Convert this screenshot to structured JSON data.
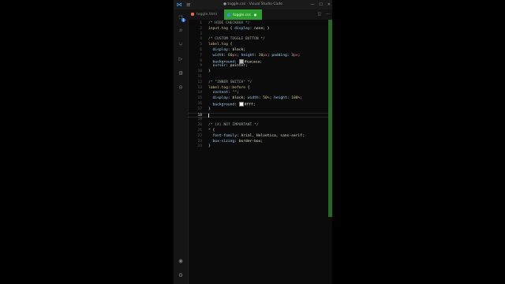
{
  "window": {
    "title": "● toggle.css - Visual Studio Code"
  },
  "colors": {
    "accent": "#2c9e2c",
    "background": "#0b0b0b",
    "swatch_tag": "#bbb",
    "swatch_fff": "#ffffff"
  },
  "icons": {
    "app": "vscode-logo-icon",
    "menu": "hamburger-menu-icon",
    "activity": [
      "explorer-icon",
      "search-icon",
      "source-control-icon",
      "run-debug-icon",
      "extensions-icon",
      "remote-icon",
      "account-icon",
      "settings-gear-icon"
    ]
  },
  "activity_bar": {
    "badge_count": "1"
  },
  "tabs": [
    {
      "label": "toggle.html",
      "active": false
    },
    {
      "label": "toggle.css",
      "active": true
    }
  ],
  "tab_actions": {
    "split": "◫",
    "more": "···"
  },
  "editor": {
    "lines": [
      {
        "num": "1",
        "tokens": [
          {
            "t": "c",
            "v": "/* HIDE CHECKBOX */"
          }
        ]
      },
      {
        "num": "2",
        "tokens": [
          {
            "t": "sel",
            "v": "input.tog "
          },
          {
            "t": "b",
            "v": "{ "
          },
          {
            "t": "p",
            "v": "display"
          },
          {
            "t": "b",
            "v": ": "
          },
          {
            "t": "v",
            "v": "none"
          },
          {
            "t": "b",
            "v": "; }"
          }
        ]
      },
      {
        "num": "3",
        "tokens": []
      },
      {
        "num": "4",
        "tokens": [
          {
            "t": "c",
            "v": "/* CUSTOM TOGGLE BUTTON */"
          }
        ]
      },
      {
        "num": "5",
        "tokens": [
          {
            "t": "sel",
            "v": "label.tog "
          },
          {
            "t": "b",
            "v": "{"
          }
        ]
      },
      {
        "num": "6",
        "tokens": [
          {
            "t": "p",
            "v": "  display"
          },
          {
            "t": "b",
            "v": ": "
          },
          {
            "t": "v",
            "v": "block"
          },
          {
            "t": "b",
            "v": ";"
          }
        ]
      },
      {
        "num": "7",
        "tokens": [
          {
            "t": "p",
            "v": "  width"
          },
          {
            "t": "b",
            "v": ": "
          },
          {
            "t": "n",
            "v": "60"
          },
          {
            "t": "u",
            "v": "px"
          },
          {
            "t": "b",
            "v": "; "
          },
          {
            "t": "p",
            "v": "height"
          },
          {
            "t": "b",
            "v": ": "
          },
          {
            "t": "n",
            "v": "30"
          },
          {
            "t": "u",
            "v": "px"
          },
          {
            "t": "b",
            "v": "; "
          },
          {
            "t": "p",
            "v": "padding"
          },
          {
            "t": "b",
            "v": ": "
          },
          {
            "t": "n",
            "v": "3"
          },
          {
            "t": "u",
            "v": "px"
          },
          {
            "t": "b",
            "v": ";"
          }
        ]
      },
      {
        "num": "8",
        "tokens": [
          {
            "t": "p",
            "v": "  background"
          },
          {
            "t": "b",
            "v": ": "
          },
          {
            "t": "sw",
            "v": "#bbb"
          },
          {
            "t": "v",
            "v": "#cacaca"
          },
          {
            "t": "b",
            "v": ";"
          }
        ]
      },
      {
        "num": "9",
        "tokens": [
          {
            "t": "p",
            "v": "  cursor"
          },
          {
            "t": "b",
            "v": ": "
          },
          {
            "t": "v",
            "v": "pointer"
          },
          {
            "t": "b",
            "v": ";"
          }
        ]
      },
      {
        "num": "10",
        "tokens": [
          {
            "t": "b",
            "v": "}"
          }
        ]
      },
      {
        "num": "11",
        "tokens": []
      },
      {
        "num": "12",
        "tokens": [
          {
            "t": "c",
            "v": "/* \"INNER SWITCH\" */"
          }
        ]
      },
      {
        "num": "13",
        "tokens": [
          {
            "t": "sel",
            "v": "label.tog::before "
          },
          {
            "t": "b",
            "v": "{"
          }
        ]
      },
      {
        "num": "14",
        "tokens": [
          {
            "t": "p",
            "v": "  content"
          },
          {
            "t": "b",
            "v": ": "
          },
          {
            "t": "s",
            "v": "\"\""
          },
          {
            "t": "b",
            "v": ";"
          }
        ]
      },
      {
        "num": "15",
        "tokens": [
          {
            "t": "p",
            "v": "  display"
          },
          {
            "t": "b",
            "v": ": "
          },
          {
            "t": "v",
            "v": "block"
          },
          {
            "t": "b",
            "v": "; "
          },
          {
            "t": "p",
            "v": "width"
          },
          {
            "t": "b",
            "v": ": "
          },
          {
            "t": "n",
            "v": "50"
          },
          {
            "t": "u",
            "v": "%"
          },
          {
            "t": "b",
            "v": "; "
          },
          {
            "t": "p",
            "v": "height"
          },
          {
            "t": "b",
            "v": ": "
          },
          {
            "t": "n",
            "v": "100"
          },
          {
            "t": "u",
            "v": "%"
          },
          {
            "t": "b",
            "v": ";"
          }
        ]
      },
      {
        "num": "16",
        "tokens": [
          {
            "t": "p",
            "v": "  background"
          },
          {
            "t": "b",
            "v": ": "
          },
          {
            "t": "sw",
            "v": "#fff"
          },
          {
            "t": "v",
            "v": "#fff"
          },
          {
            "t": "b",
            "v": ";"
          }
        ]
      },
      {
        "num": "17",
        "tokens": [
          {
            "t": "b",
            "v": "}"
          }
        ]
      },
      {
        "num": "18",
        "tokens": [
          {
            "t": "cur",
            "v": ""
          }
        ],
        "current": true
      },
      {
        "num": "19",
        "tokens": []
      },
      {
        "num": "20",
        "tokens": [
          {
            "t": "c",
            "v": "/* (X) NOT IMPORTANT */"
          }
        ]
      },
      {
        "num": "21",
        "tokens": [
          {
            "t": "sel",
            "v": "* "
          },
          {
            "t": "b",
            "v": "{"
          }
        ]
      },
      {
        "num": "22",
        "tokens": [
          {
            "t": "p",
            "v": "  font-family"
          },
          {
            "t": "b",
            "v": ": "
          },
          {
            "t": "v",
            "v": "Arial, Helvetica, sans-serif"
          },
          {
            "t": "b",
            "v": ";"
          }
        ]
      },
      {
        "num": "23",
        "tokens": [
          {
            "t": "p",
            "v": "  box-sizing"
          },
          {
            "t": "b",
            "v": ": "
          },
          {
            "t": "v",
            "v": "border-box"
          },
          {
            "t": "b",
            "v": ";"
          }
        ]
      },
      {
        "num": "24",
        "tokens": [
          {
            "t": "b",
            "v": "}"
          }
        ]
      }
    ]
  }
}
